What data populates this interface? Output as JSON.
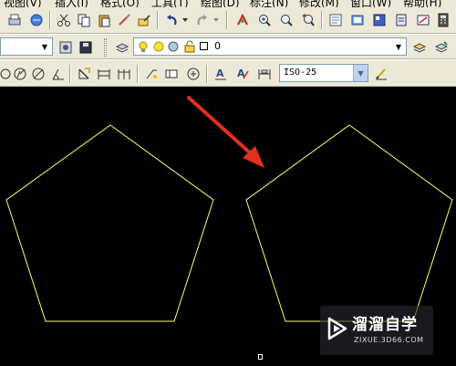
{
  "menu": {
    "items": [
      {
        "label": "视图(V)"
      },
      {
        "label": "插入(I)"
      },
      {
        "label": "格式(O)"
      },
      {
        "label": "工具(T)"
      },
      {
        "label": "绘图(D)"
      },
      {
        "label": "标注(N)"
      },
      {
        "label": "修改(M)"
      },
      {
        "label": "窗口(W)"
      },
      {
        "label": "帮助(H)"
      }
    ]
  },
  "toolbar_layers": {
    "current_layer": "0"
  },
  "toolbar_dim": {
    "dim_style": "ISO-25"
  },
  "watermark": {
    "title": "溜溜自学",
    "url": "ZIXUE.3D66.COM"
  },
  "colors": {
    "background": "#000000",
    "pentagon_stroke": "#ffff66",
    "arrow": "#e0301e"
  }
}
